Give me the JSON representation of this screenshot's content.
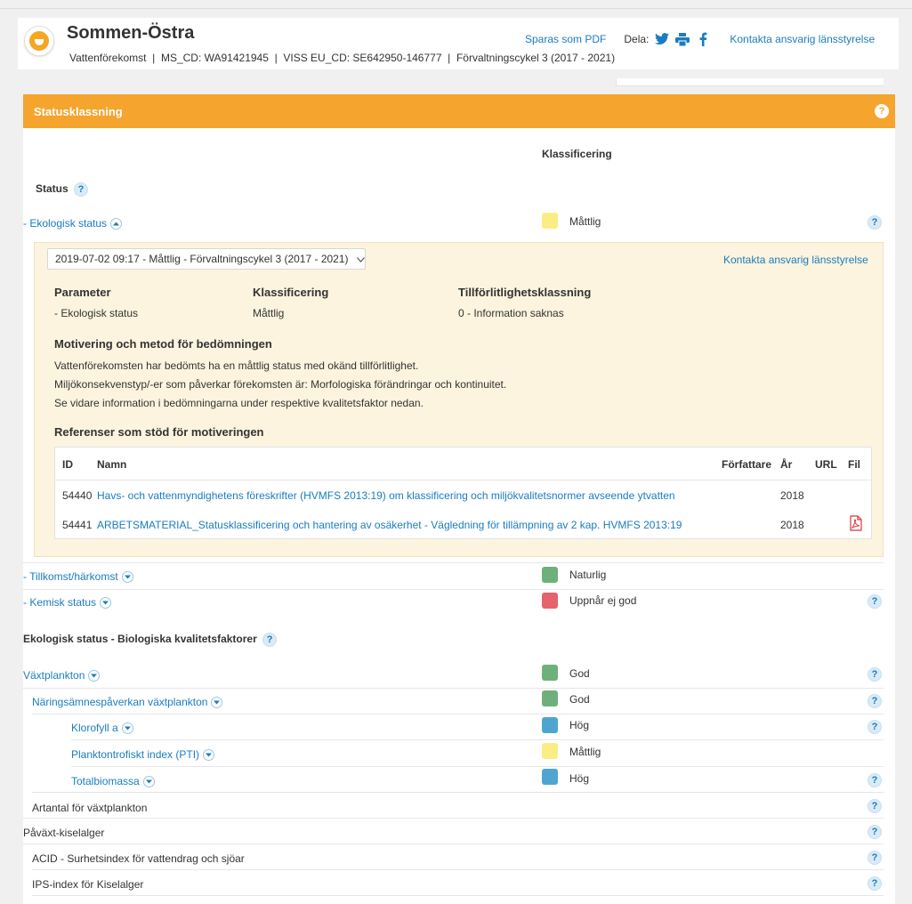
{
  "header": {
    "title": "Sommen-Östra",
    "type": "Vattenförekomst",
    "ms_cd": "MS_CD: WA91421945",
    "viss_cd": "VISS EU_CD: SE642950-146777",
    "cycle": "Förvaltningscykel 3 (2017 - 2021)",
    "separator": "|",
    "save_pdf": "Sparas som PDF",
    "share_label": "Dela:",
    "contact": "Kontakta ansvarig länsstyrelse"
  },
  "panel": {
    "title": "Statusklassning",
    "column_header": "Klassificering",
    "status_heading": "Status"
  },
  "eco_status": {
    "label": "- Ekologisk status",
    "value": "Måttlig",
    "version": "2019-07-02 09:17 - Måttlig - Förvaltningscykel 3 (2017 - 2021)",
    "contact": "Kontakta ansvarig länsstyrelse",
    "param_header": "Parameter",
    "class_header": "Klassificering",
    "reliability_header": "Tillförlitlighetsklassning",
    "param_value": "- Ekologisk status",
    "class_value": "Måttlig",
    "reliability_value": "0 - Information saknas",
    "motivation_heading": "Motivering och metod för bedömningen",
    "motivation_lines": [
      "Vattenförekomsten har bedömts ha en måttlig status med okänd tillförlitlighet.",
      "Miljökonsekvenstyp/-er som påverkar förekomsten är: Morfologiska förändringar och kontinuitet.",
      "Se vidare information i bedömningarna under respektive kvalitetsfaktor nedan."
    ],
    "refs_heading": "Referenser som stöd för motiveringen",
    "refs_columns": {
      "id": "ID",
      "name": "Namn",
      "author": "Författare",
      "year": "År",
      "url": "URL",
      "file": "Fil"
    },
    "refs": [
      {
        "id": "54440",
        "name": "Havs- och vattenmyndighetens föreskrifter (HVMFS 2013:19) om klassificering och miljökvalitetsnormer avseende ytvatten",
        "year": "2018"
      },
      {
        "id": "54441",
        "name": "ARBETSMATERIAL_Statusklassificering och hantering av osäkerhet - Vägledning för tillämpning av 2 kap. HVMFS 2013:19",
        "year": "2018"
      }
    ]
  },
  "rows": {
    "origin": {
      "label": "- Tillkomst/härkomst",
      "value": "Naturlig"
    },
    "chemical": {
      "label": "- Kemisk status",
      "value": "Uppnår ej god"
    },
    "bio_heading": "Ekologisk status - Biologiska kvalitetsfaktorer",
    "phyto": {
      "label": "Växtplankton",
      "value": "God"
    },
    "nutrient": {
      "label": "Näringsämnespåverkan växtplankton",
      "value": "God"
    },
    "chlorophyll": {
      "label": "Klorofyll a",
      "value": "Hög"
    },
    "pti": {
      "label": "Planktontrofiskt index (PTI)",
      "value": "Måttlig"
    },
    "biomass": {
      "label": "Totalbiomassa",
      "value": "Hög"
    },
    "species": {
      "label": "Artantal för växtplankton"
    },
    "diatoms": {
      "label": "Påväxt-kiselalger"
    },
    "acid": {
      "label": "ACID - Surhetsindex för vattendrag och sjöar"
    },
    "ips": {
      "label": "IPS-index för Kiselalger"
    }
  },
  "help_glyph": "?",
  "colors": {
    "orange": "#f5a42e",
    "moderate": "#fbed85",
    "good": "#6fb07a",
    "high": "#4ea6d0",
    "fail": "#e5636a",
    "link": "#1a7cc0"
  }
}
